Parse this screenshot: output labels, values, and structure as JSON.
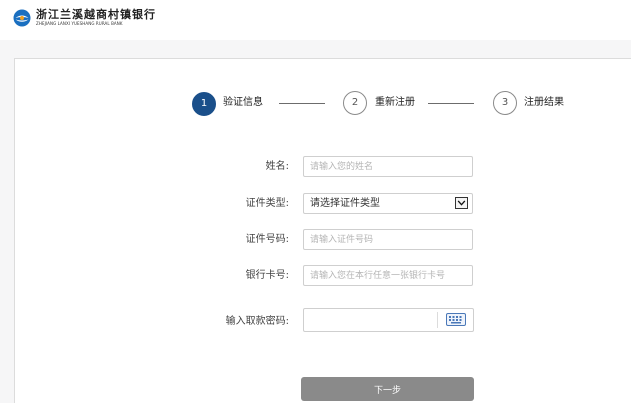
{
  "brand": {
    "name_cn": "浙江兰溪越商村镇银行",
    "name_en": "ZHEJIANG LANXI YUESHANG RURAL BANK",
    "accent_color": "#1a4f8a"
  },
  "steps": [
    {
      "num": "1",
      "label": "验证信息",
      "active": true
    },
    {
      "num": "2",
      "label": "重新注册",
      "active": false
    },
    {
      "num": "3",
      "label": "注册结果",
      "active": false
    }
  ],
  "form": {
    "name_label": "姓名:",
    "name_placeholder": "请输入您的姓名",
    "idtype_label": "证件类型:",
    "idtype_value": "请选择证件类型",
    "idno_label": "证件号码:",
    "idno_placeholder": "请输入证件号码",
    "card_label": "银行卡号:",
    "card_placeholder": "请输入您在本行任意一张银行卡号",
    "password_label": "输入取款密码:",
    "keyboard_icon": "keyboard-icon",
    "next_label": "下一步"
  }
}
